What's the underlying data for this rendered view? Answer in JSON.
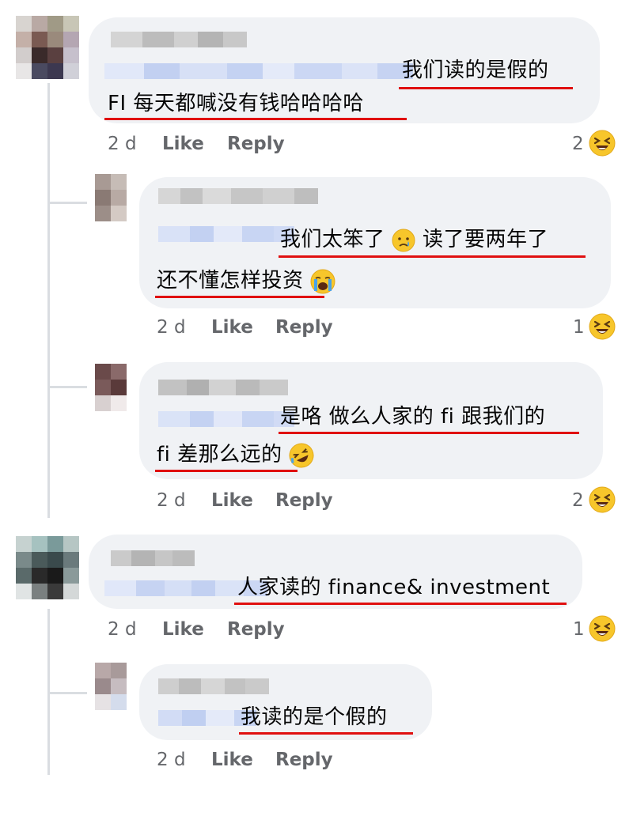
{
  "comments": [
    {
      "id": "c1",
      "text_lines": [
        "我们读的是假的",
        "FI 每天都喊没有钱哈哈哈哈"
      ],
      "age": "2 d",
      "like": "Like",
      "reply": "Reply",
      "reaction_count": "2",
      "reaction": "laughing-emoji"
    },
    {
      "id": "c2",
      "text_lines": [
        "我们太笨了",
        "读了要两年了",
        "还不懂怎样投资"
      ],
      "age": "2 d",
      "like": "Like",
      "reply": "Reply",
      "reaction_count": "1",
      "reaction": "laughing-emoji"
    },
    {
      "id": "c3",
      "text_lines": [
        "是咯 做么人家的 fi 跟我们的",
        "fi 差那么远的"
      ],
      "age": "2 d",
      "like": "Like",
      "reply": "Reply",
      "reaction_count": "2",
      "reaction": "laughing-emoji"
    },
    {
      "id": "c4",
      "text_lines": [
        "人家读的 finance& investment"
      ],
      "age": "2 d",
      "like": "Like",
      "reply": "Reply",
      "reaction_count": "1",
      "reaction": "laughing-emoji"
    },
    {
      "id": "c5",
      "text_lines": [
        "我读的是个假的"
      ],
      "age": "2 d",
      "like": "Like",
      "reply": "Reply"
    }
  ],
  "colors": {
    "bubble": "#f0f2f5",
    "underline": "#e01010",
    "meta": "#65676b",
    "blur_name": "#c6c6c6",
    "blur_tag": "#c9d6f3"
  }
}
